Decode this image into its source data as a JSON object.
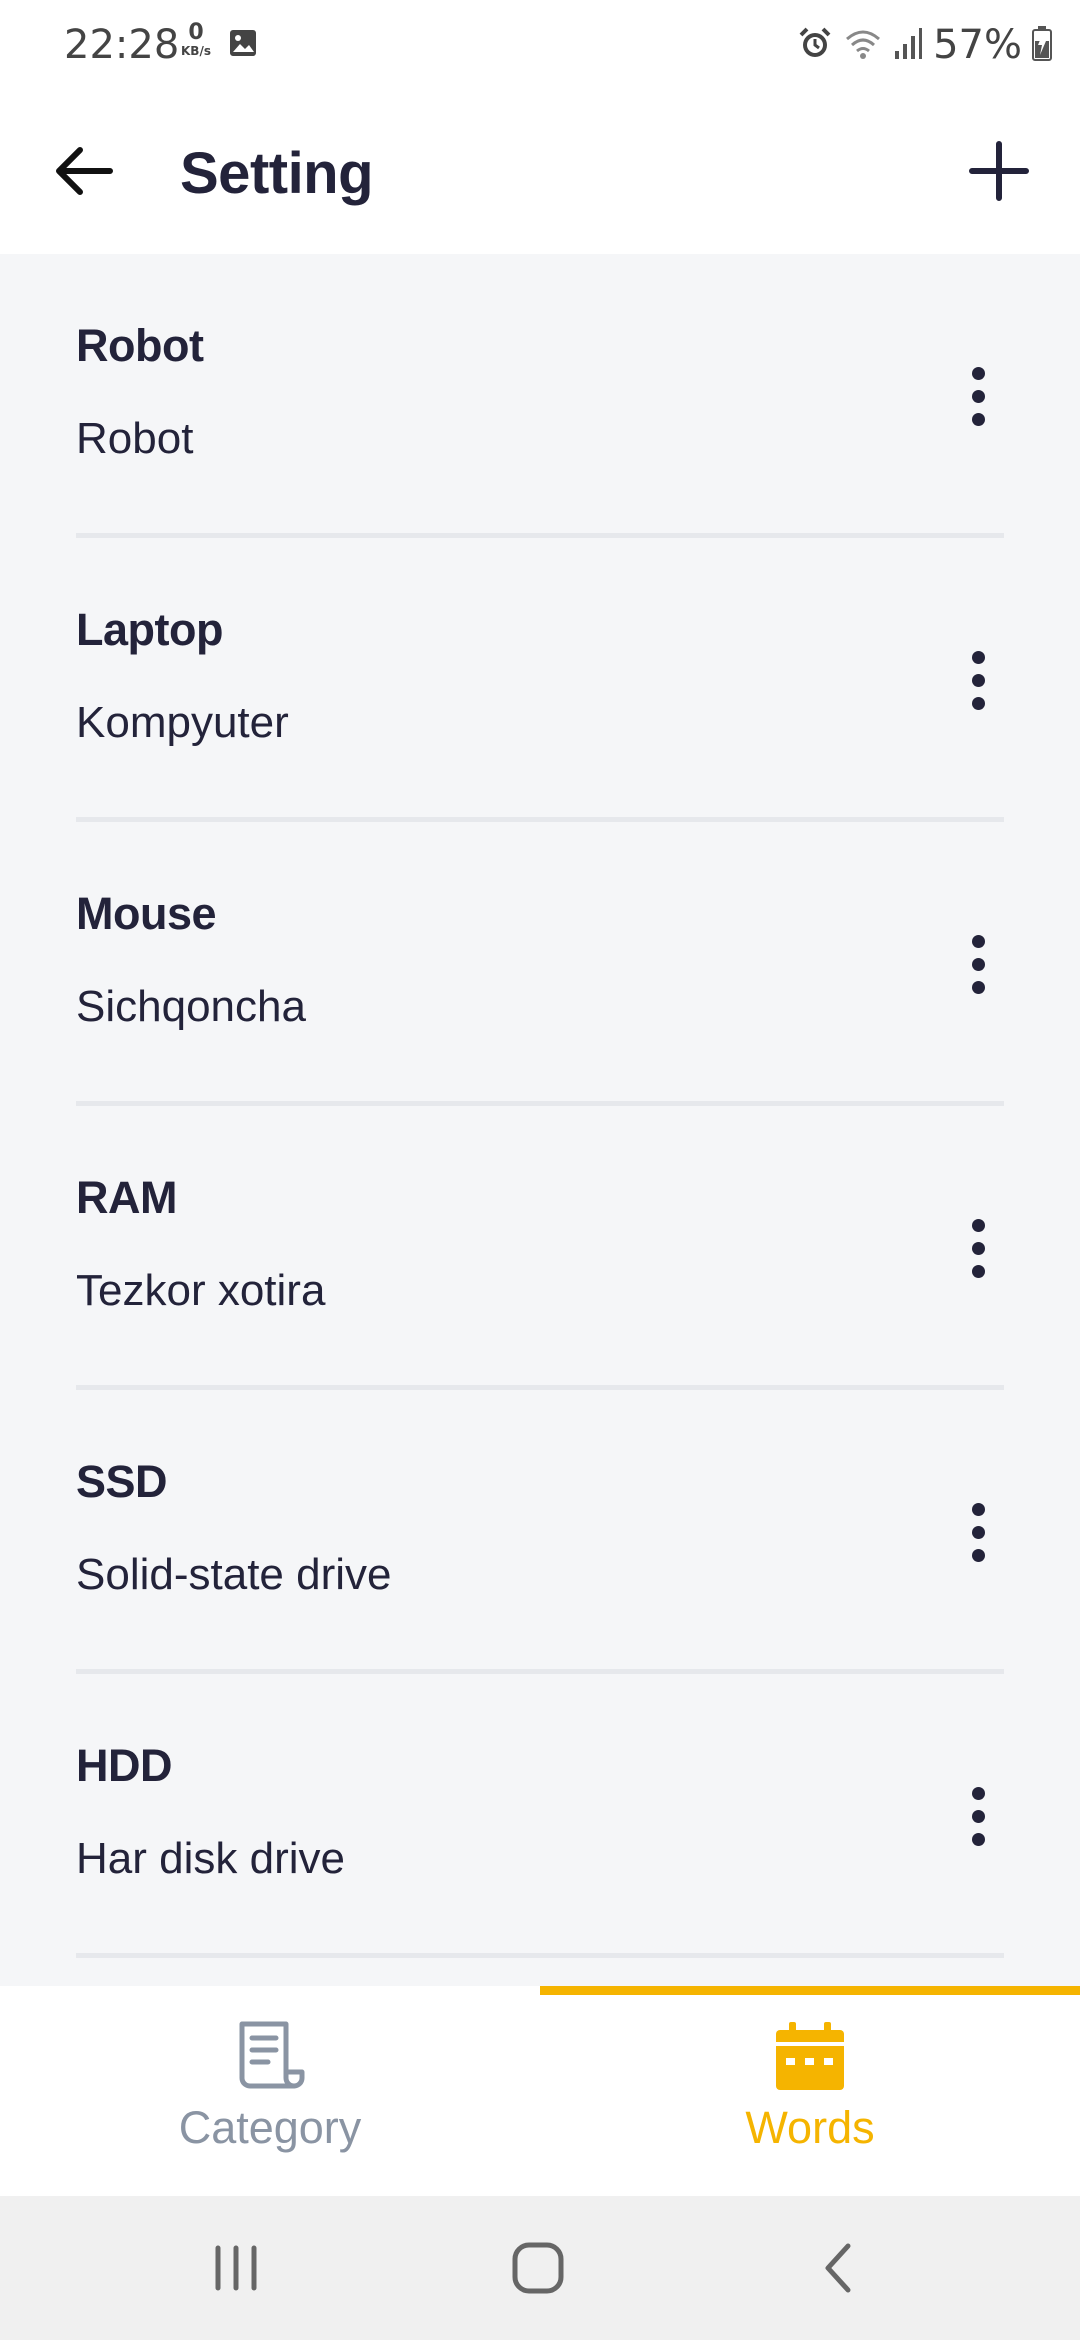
{
  "status_bar": {
    "time": "22:28",
    "net_speed_value": "0",
    "net_speed_unit": "KB/s",
    "battery": "57%",
    "icons": [
      "gallery-icon",
      "alarm-icon",
      "wifi-icon",
      "signal-icon",
      "battery-charging-icon"
    ]
  },
  "header": {
    "title": "Setting",
    "back_icon": "arrow-left-icon",
    "add_icon": "plus-icon"
  },
  "words": [
    {
      "word": "Robot",
      "translation": "Robot"
    },
    {
      "word": "Laptop",
      "translation": "Kompyuter"
    },
    {
      "word": "Mouse",
      "translation": "Sichqoncha"
    },
    {
      "word": "RAM",
      "translation": "Tezkor xotira"
    },
    {
      "word": "SSD",
      "translation": "Solid-state drive"
    },
    {
      "word": "HDD",
      "translation": "Har disk drive"
    }
  ],
  "bottom_nav": {
    "tabs": [
      {
        "label": "Category",
        "icon": "document-icon",
        "active": false
      },
      {
        "label": "Words",
        "icon": "calendar-icon",
        "active": true
      }
    ],
    "accent_color": "#f5b400",
    "inactive_color": "#8a94a3"
  },
  "colors": {
    "text_primary": "#23233a",
    "list_background": "#f5f6f8",
    "divider": "#e6e8ec"
  }
}
